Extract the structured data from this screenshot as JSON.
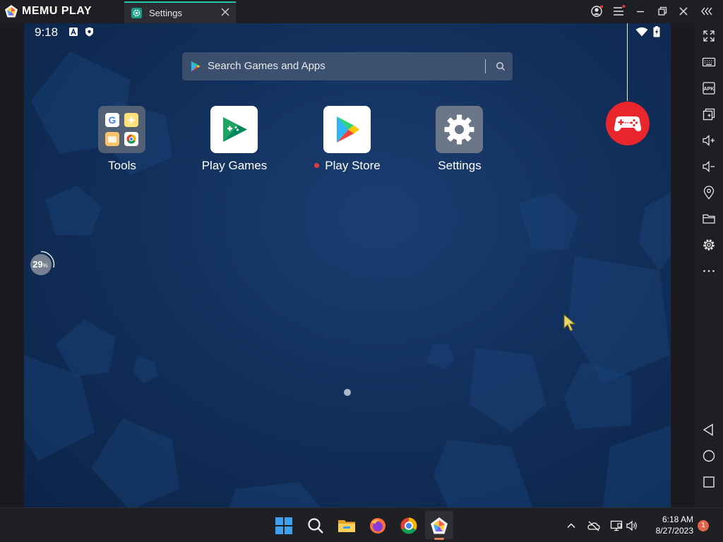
{
  "window": {
    "brand": "MEMU PLAY",
    "tab_title": "Settings",
    "icons": [
      "memu-logo-icon",
      "settings-tab-icon",
      "close-tab-icon",
      "account-icon",
      "menu-icon",
      "minimize-icon",
      "restore-icon",
      "close-icon",
      "collapse-sidebar-icon"
    ]
  },
  "status_bar": {
    "time": "9:18",
    "icons": [
      "a-notification-icon",
      "shield-icon",
      "wifi-icon",
      "battery-icon"
    ]
  },
  "search": {
    "placeholder": "Search Games and Apps",
    "icons": [
      "play-logo-icon",
      "search-icon"
    ]
  },
  "apps": [
    {
      "label": "Tools",
      "icon": "tools-folder-icon"
    },
    {
      "label": "Play Games",
      "icon": "play-games-icon"
    },
    {
      "label": "Play Store",
      "icon": "play-store-icon",
      "new_indicator": true
    },
    {
      "label": "Settings",
      "icon": "settings-gear-icon"
    }
  ],
  "progress": {
    "value": 29,
    "label": "29",
    "unit": "%"
  },
  "sidebar": {
    "items": [
      "fullscreen-icon",
      "keyboard-icon",
      "apk-icon",
      "multi-instance-icon",
      "volume-up-icon",
      "volume-down-icon",
      "location-icon",
      "folder-icon",
      "settings-icon",
      "more-icon",
      "back-icon",
      "home-icon",
      "recents-icon"
    ],
    "apk_label": "APK"
  },
  "taskbar": {
    "apps": [
      "windows-start-icon",
      "search-icon",
      "file-explorer-icon",
      "firefox-icon",
      "chrome-icon",
      "memu-icon"
    ],
    "tray": [
      "chevron-up-icon",
      "onedrive-icon",
      "network-icon",
      "volume-icon"
    ],
    "time": "6:18 AM",
    "date": "8/27/2023",
    "notification_count": "1"
  },
  "colors": {
    "accent": "#23c7a8",
    "gamepad": "#e8262b",
    "notification": "#e0644e"
  }
}
